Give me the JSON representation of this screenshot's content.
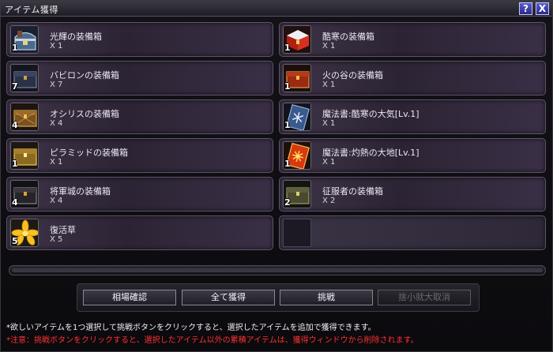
{
  "window": {
    "title": "アイテム獲得",
    "help_label": "?",
    "close_label": "X"
  },
  "items_left": [
    {
      "name": "光輝の装備箱",
      "qty": "X 1",
      "count": "1",
      "icon": "chest-silver-icon"
    },
    {
      "name": "バビロンの装備箱",
      "qty": "X 7",
      "count": "7",
      "icon": "chest-navy-icon"
    },
    {
      "name": "オシリスの装備箱",
      "qty": "X 4",
      "count": "4",
      "icon": "chest-bronze-icon"
    },
    {
      "name": "ピラミッドの装備箱",
      "qty": "X 1",
      "count": "1",
      "icon": "chest-gold-icon"
    },
    {
      "name": "将軍城の装備箱",
      "qty": "X 4",
      "count": "4",
      "icon": "chest-black-icon"
    },
    {
      "name": "復活草",
      "qty": "X 5",
      "count": "5",
      "icon": "herb-flower-icon"
    }
  ],
  "items_right": [
    {
      "name": "酷寒の装備箱",
      "qty": "X 1",
      "count": "1",
      "icon": "chest-red-white-icon"
    },
    {
      "name": "火の谷の装備箱",
      "qty": "X 1",
      "count": "1",
      "icon": "chest-red-icon"
    },
    {
      "name": "魔法書:酷寒の大気[Lv.1]",
      "qty": "X 1",
      "count": "1",
      "icon": "spellbook-ice-icon"
    },
    {
      "name": "魔法書:灼熱の大地[Lv.1]",
      "qty": "X 1",
      "count": "1",
      "icon": "spellbook-fire-icon"
    },
    {
      "name": "征服者の装備箱",
      "qty": "X 2",
      "count": "2",
      "icon": "chest-olive-icon"
    }
  ],
  "buttons": {
    "market": "相場確認",
    "get_all": "全て獲得",
    "challenge": "挑戦",
    "cancel": "捨小就大取消"
  },
  "notes": {
    "line1": "*欲しいアイテムを1つ選択して挑戦ボタンをクリックすると、選択したアイテムを追加で獲得できます。",
    "line2": "*注意：挑戦ボタンをクリックすると、選択したアイテム以外の累積アイテムは、獲得ウィンドウから削除されます。"
  },
  "colors": {
    "accent": "#5a5ad0",
    "warning": "#ff3030"
  }
}
